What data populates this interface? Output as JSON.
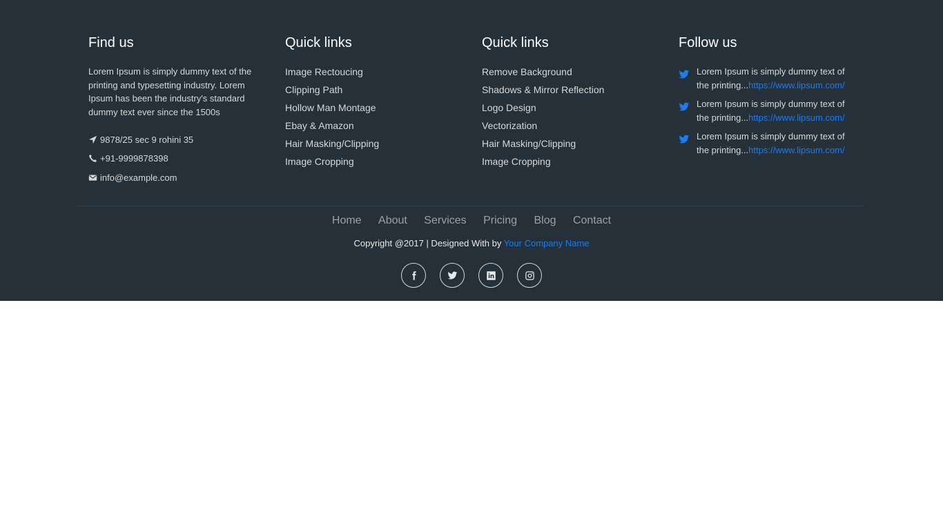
{
  "find_us": {
    "title": "Find us",
    "text": "Lorem Ipsum is simply dummy text of the printing and typesetting industry. Lorem Ipsum has been the industry's standard dummy text ever since the 1500s",
    "address": "9878/25 sec 9 rohini 35",
    "phone": "+91-9999878398",
    "email": "info@example.com",
    "icons": [
      "location-arrow-icon",
      "phone-icon",
      "envelope-icon"
    ]
  },
  "quick_links_1": {
    "title": "Quick links",
    "items": [
      "Image Rectoucing",
      "Clipping Path",
      "Hollow Man Montage",
      "Ebay & Amazon",
      "Hair Masking/Clipping",
      "Image Cropping"
    ]
  },
  "quick_links_2": {
    "title": "Quick links",
    "items": [
      "Remove Background",
      "Shadows & Mirror Reflection",
      "Logo Design",
      "Vectorization",
      "Hair Masking/Clipping",
      "Image Cropping"
    ]
  },
  "follow_us": {
    "title": "Follow us",
    "tweets": [
      {
        "text": "Lorem Ipsum is simply dummy text of the printing...",
        "link": "https://www.lipsum.com/"
      },
      {
        "text": "Lorem Ipsum is simply dummy text of the printing...",
        "link": "https://www.lipsum.com/"
      },
      {
        "text": "Lorem Ipsum is simply dummy text of the printing...",
        "link": "https://www.lipsum.com/"
      }
    ],
    "icon": "twitter-icon"
  },
  "nav": {
    "items": [
      "Home",
      "About",
      "Services",
      "Pricing",
      "Blog",
      "Contact"
    ]
  },
  "copyright": {
    "text": "Copyright @2017 | Designed With by ",
    "company": "Your Company Name"
  },
  "social": {
    "icons": [
      "facebook-icon",
      "twitter-icon",
      "linkedin-icon",
      "instagram-icon"
    ]
  },
  "colors": {
    "footer_bg": "#263038",
    "accent": "#1a7df0",
    "text": "#d5d8da"
  }
}
